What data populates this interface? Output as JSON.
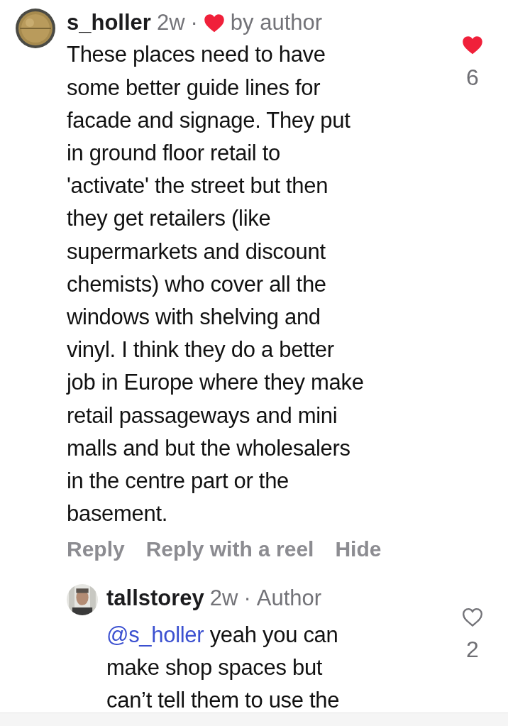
{
  "comment": {
    "username": "s_holler",
    "time": "2w",
    "separator": "·",
    "liked_by_author": true,
    "badge_text": "by author",
    "body": "These places need to have\nsome better guide lines for\nfacade and signage. They put\nin ground floor retail to\n'activate' the street but then\nthey get retailers (like\nsupermarkets and discount\nchemists) who cover all the\nwindows with shelving and\nvinyl. I think they do a better\njob in Europe where they make\nretail passageways and mini\nmalls and but the wholesalers\nin the centre part or the\nbasement.",
    "liked": true,
    "likes": "6",
    "actions": [
      "Reply",
      "Reply with a reel",
      "Hide"
    ]
  },
  "reply": {
    "username": "tallstorey",
    "time": "2w",
    "separator": "·",
    "role": "Author",
    "mention": "@s_holler",
    "body": " yeah you can\nmake shop spaces but\ncan’t tell them to use the",
    "liked": false,
    "likes": "2"
  }
}
